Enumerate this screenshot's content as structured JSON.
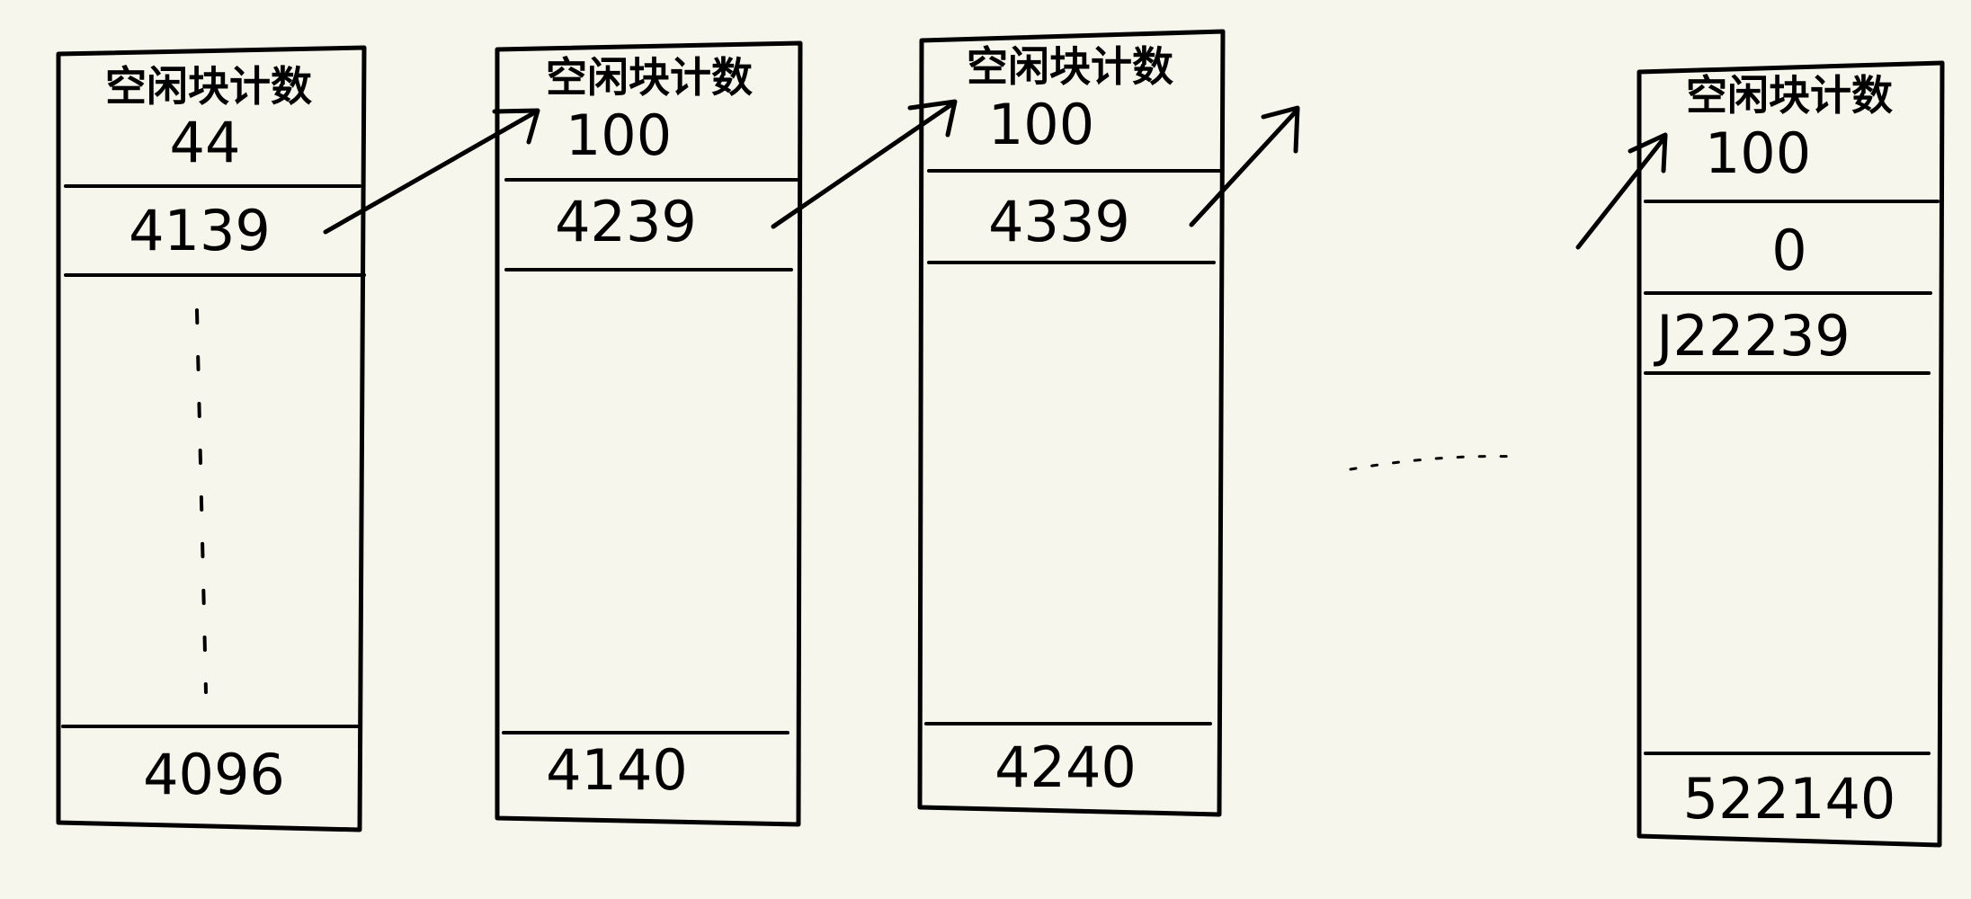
{
  "blocks": [
    {
      "header_label": "空闲块计数",
      "count": "44",
      "first_entry": "4139",
      "middle_entries": "ellipsis",
      "last_entry": "4096"
    },
    {
      "header_label": "空闲块计数",
      "count": "100",
      "first_entry": "4239",
      "last_entry": "4140"
    },
    {
      "header_label": "空闲块计数",
      "count": "100",
      "first_entry": "4339",
      "last_entry": "4240"
    },
    {
      "header_label": "空闲块计数",
      "count": "100",
      "first_entry": "0",
      "second_entry": "J22239",
      "last_entry": "522140"
    }
  ],
  "colors": {
    "background": "#f7f6ec",
    "ink": "#000000"
  }
}
